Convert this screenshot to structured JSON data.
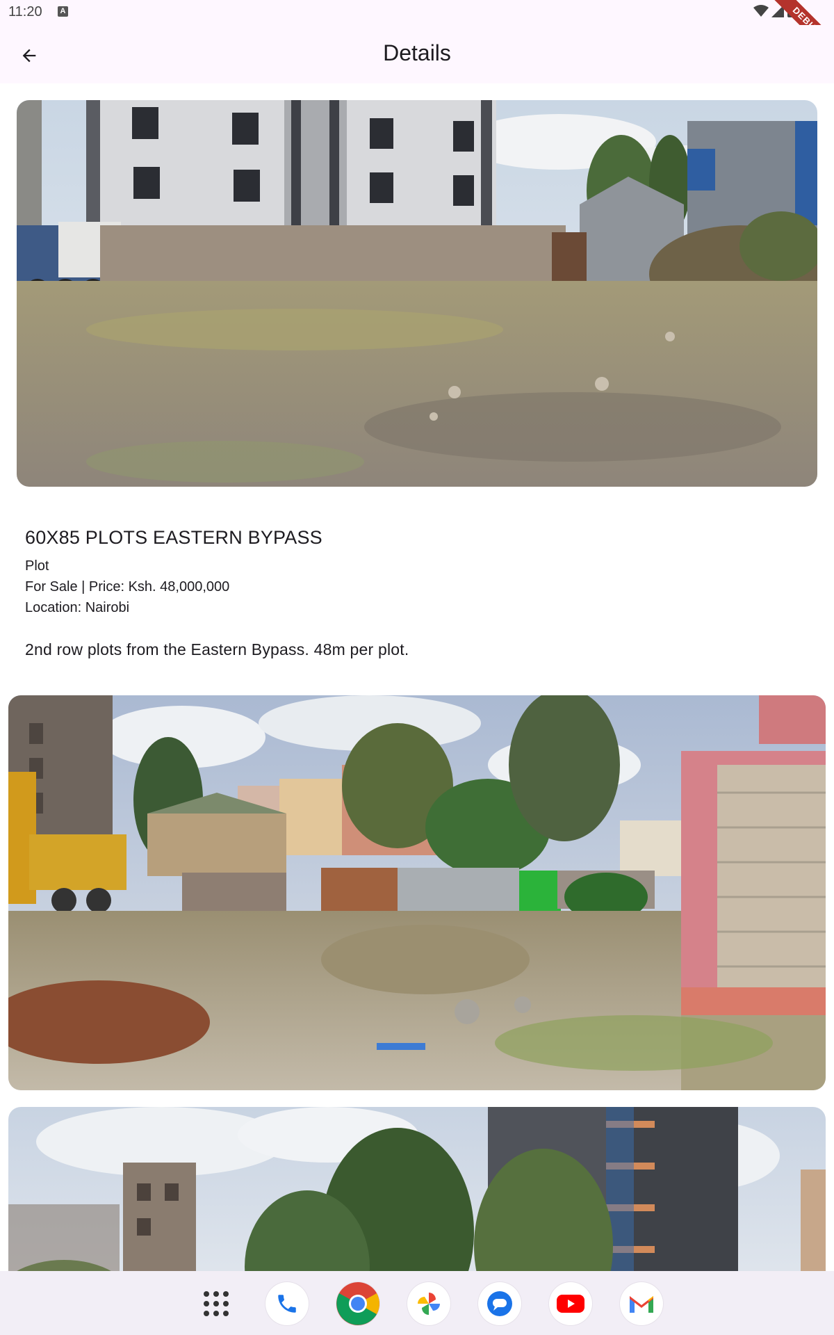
{
  "status_bar": {
    "time": "11:20",
    "badge": "A",
    "debug_label": "DEBUG"
  },
  "app_bar": {
    "title": "Details",
    "back_icon": "arrow-back-icon"
  },
  "listing": {
    "title": "60X85 PLOTS EASTERN BYPASS",
    "type": "Plot",
    "sale_price": "For Sale | Price: Ksh. 48,000,000",
    "location": "Location: Nairobi",
    "description": "2nd row plots from the Eastern Bypass. 48m per plot."
  },
  "dock": {
    "apps": [
      "apps-grid-icon",
      "phone-icon",
      "chrome-icon",
      "photos-icon",
      "messages-icon",
      "youtube-icon",
      "gmail-icon"
    ]
  },
  "colors": {
    "app_bar_bg": "#fef7ff",
    "dock_bg": "#f2eef6",
    "debug_ribbon": "#b4332c"
  }
}
